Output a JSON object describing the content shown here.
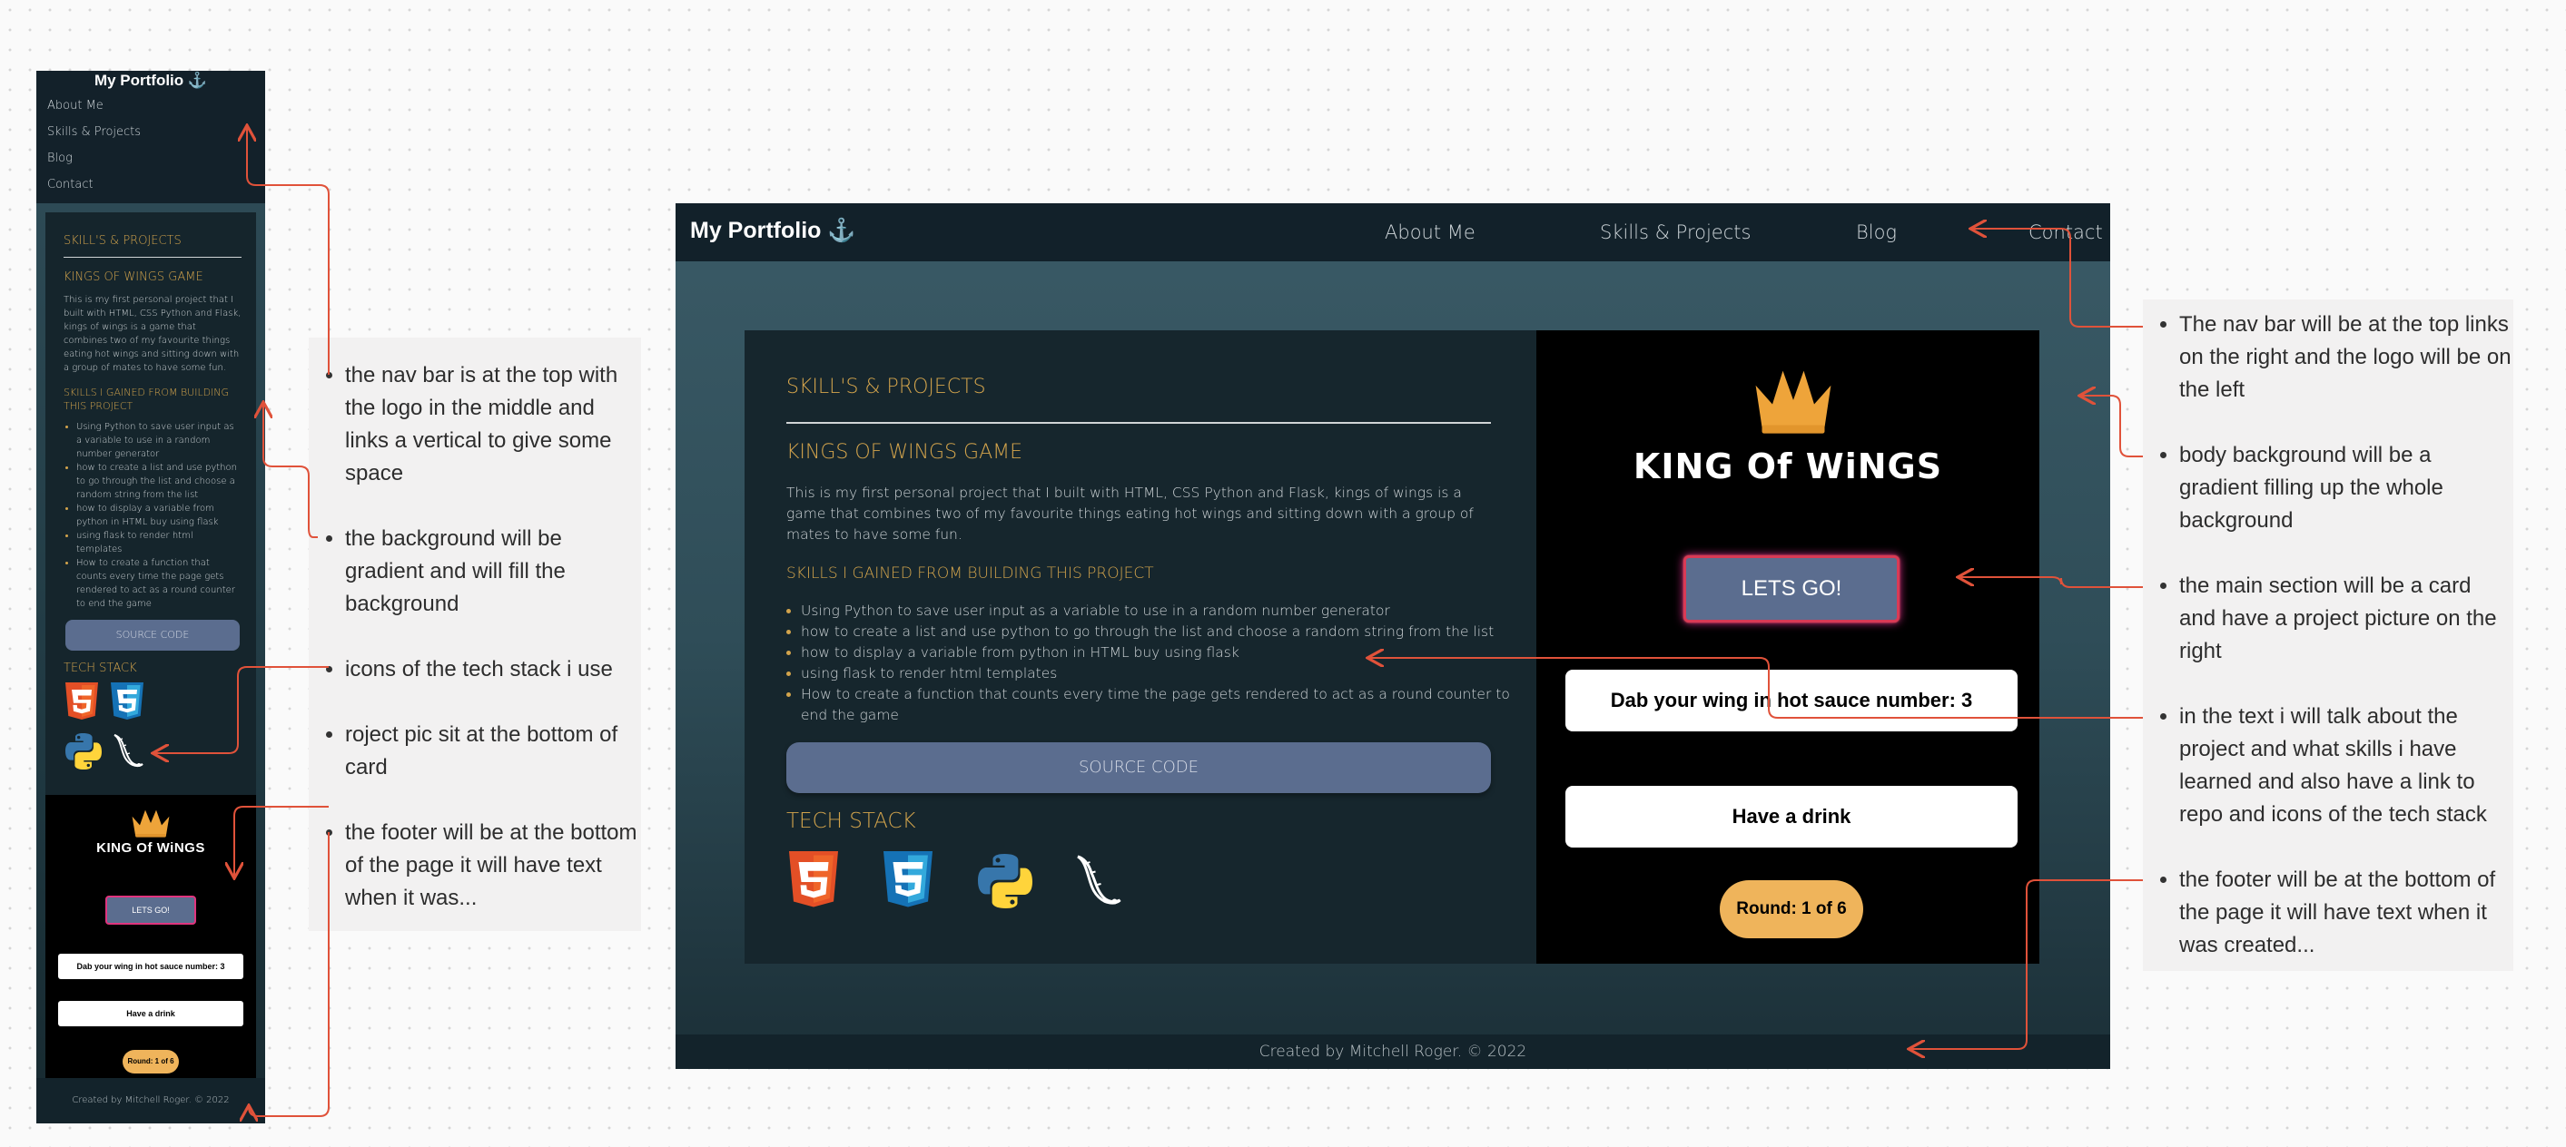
{
  "mobile": {
    "logo": "My Portfolio",
    "nav": [
      "About Me",
      "Skills & Projects",
      "Blog",
      "Contact"
    ],
    "heading": "SKILL'S & PROJECTS",
    "project_title": "KINGS OF WINGS GAME",
    "description": "This is my first personal project that I built with HTML, CSS Python and Flask, kings of wings is a game that combines two of my favourite things eating hot wings and sitting down with a group of mates to have some fun.",
    "skills_heading": "SKILLS I GAINED FROM BUILDING THIS PROJECT",
    "skills": [
      "Using Python to save user input as a variable to use in a random number generator",
      "how to create a list and use python to go through the list and choose a random string from the list",
      "how to display a variable from python in HTML buy using flask",
      "using flask to render html templates",
      "How to create a function that counts every time the page gets rendered to act as a round counter to end the game"
    ],
    "source_button": "SOURCE CODE",
    "tech_stack": "TECH STACK",
    "project_logo_text": "KING Of WiNGS",
    "lets_go": "LETS GO!",
    "challenge": "Dab your wing in hot sauce number: 3",
    "drink": "Have a drink",
    "round": "Round: 1 of 6",
    "footer": "Created by Mitchell Roger. © 2022"
  },
  "desktop": {
    "logo": "My Portfolio",
    "nav": [
      "About Me",
      "Skills & Projects",
      "Blog",
      "Contact"
    ],
    "heading": "SKILL'S & PROJECTS",
    "project_title": "KINGS OF WINGS GAME",
    "description": "This is my first personal project that I built with HTML, CSS Python and Flask, kings of wings is a game that combines two of my favourite things eating hot wings and sitting down with a group of mates to have some fun.",
    "skills_heading": "SKILLS I GAINED FROM BUILDING THIS PROJECT",
    "skills": [
      "Using Python to save user input as a variable to use in a random number generator",
      "how to create a list and use python to go through the list and choose a random string from the list",
      "how to display a variable from python in HTML buy using flask",
      "using flask to render html templates",
      "How to create a function that counts every time the page gets rendered to act as a round counter to end the game"
    ],
    "source_button": "SOURCE CODE",
    "tech_stack": "TECH STACK",
    "project_logo_text": "KING Of WiNGS",
    "lets_go": "LETS GO!",
    "challenge": "Dab your wing in hot sauce number: 3",
    "drink": "Have a drink",
    "round": "Round: 1 of 6",
    "footer": "Created by Mitchell Roger. © 2022"
  },
  "notes_mobile": [
    " the nav bar is at the top with the logo in the middle and links a vertical to give some space",
    "the background will be gradient and will fill the background",
    "icons of the tech stack i use",
    "roject pic sit at the bottom of card",
    "the footer will be at the bottom of the page it will have text when it was..."
  ],
  "notes_desktop": [
    " The nav bar will be at the top links on the right and the logo will be on the left",
    "body background will be a gradient filling up the whole background",
    "the main section will be a card and have a project picture on the right",
    "in the text i will talk about the project and what  skills i have learned and also have a link to repo and icons of the tech stack",
    "the footer will be at the bottom of the page it will have text when it was created..."
  ],
  "tech_icons": [
    "html5-icon",
    "css3-icon",
    "python-icon",
    "flask-icon"
  ],
  "colors": {
    "nav_bg": "#12212a",
    "accent_gold": "#d3a44c",
    "button": "#5b6d8f",
    "round_badge": "#efb45b",
    "arrow": "#e0523a"
  }
}
